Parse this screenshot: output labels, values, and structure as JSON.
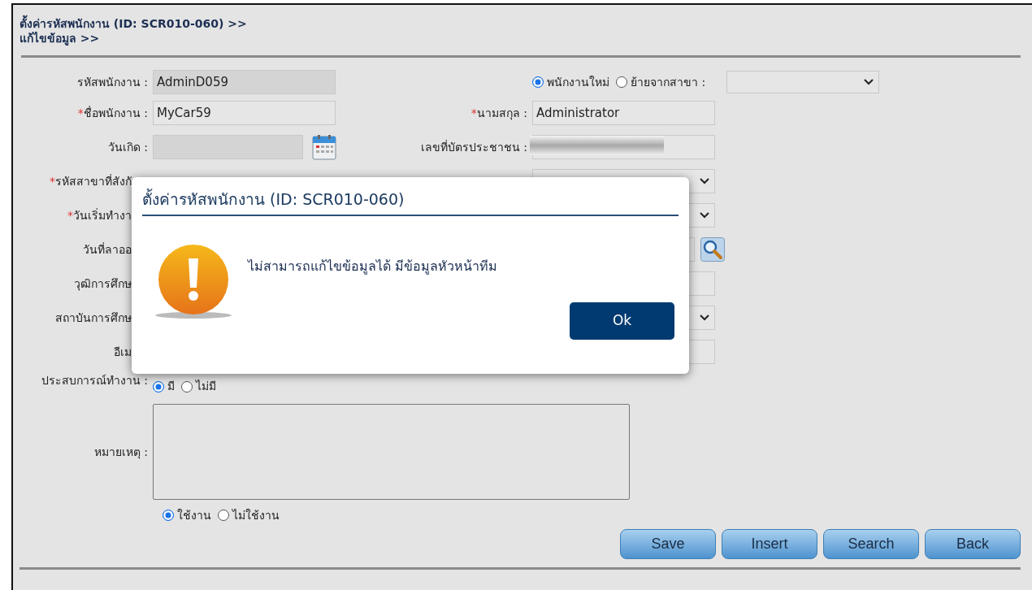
{
  "header": {
    "title": "ตั้งค่ารหัสพนักงาน (ID: SCR010-060) >>",
    "breadcrumb": "แก้ไขข้อมูล >>"
  },
  "employee_type": {
    "options": [
      {
        "label": "พนักงานใหม่",
        "selected": true
      },
      {
        "label": "ย้ายจากสาขา :",
        "selected": false
      }
    ]
  },
  "first_field": {
    "label": "รหัสพนักงาน :",
    "kind": "text",
    "value": "AdminD059",
    "disabled": true
  },
  "rows": [
    {
      "covered": false,
      "left": {
        "mark": "*",
        "label": "ชื่อพนักงาน :",
        "kind": "text",
        "value": "MyCar59",
        "disabled": false
      },
      "right": {
        "mark": "*",
        "label": "นามสกุล :",
        "kind": "text",
        "value": "Administrator",
        "disabled": false
      }
    },
    {
      "covered": false,
      "left": {
        "label": "วันเกิด :",
        "kind": "date",
        "disabled": true
      },
      "right": {
        "label": "เลขที่บัตรประชาชน :",
        "kind": "redacted",
        "disabled": false
      }
    },
    {
      "covered": true,
      "left": {
        "mark": "*",
        "label": "รหัสสาขาที่สังกั"
      },
      "right": {
        "kind": "select"
      }
    },
    {
      "covered": true,
      "left": {
        "mark": "*",
        "label": "วันเริ่มทำงา"
      },
      "right": {
        "kind": "select"
      }
    },
    {
      "covered": true,
      "left": {
        "label": "วันที่ลาออ"
      },
      "right": {
        "kind": "lookup"
      }
    },
    {
      "covered": true,
      "left": {
        "label": "วุฒิการศึกษ"
      },
      "right": {
        "kind": "text"
      }
    },
    {
      "covered": true,
      "left": {
        "label": "สถาบันการศึกษ"
      },
      "right": {
        "kind": "select"
      }
    },
    {
      "covered": true,
      "left": {
        "label": "อีเม"
      },
      "right": {
        "kind": "text"
      }
    }
  ],
  "experience": {
    "label": "ประสบการณ์ทำงาน :",
    "options": [
      {
        "label": "มี",
        "selected": true
      },
      {
        "label": "ไม่มี",
        "selected": false
      }
    ]
  },
  "remark": {
    "label": "หมายเหตุ :"
  },
  "status": {
    "options": [
      {
        "label": "ใช้งาน",
        "selected": true
      },
      {
        "label": "ไม่ใช้งาน",
        "selected": false
      }
    ]
  },
  "buttons": [
    "Save",
    "Insert",
    "Search",
    "Back"
  ],
  "dialog": {
    "title": "ตั้งค่ารหัสพนักงาน (ID: SCR010-060)",
    "message": "ไม่สามารถแก้ไขข้อมูลได้ มีข้อมูลหัวหน้าทีม",
    "button": "Ok"
  }
}
